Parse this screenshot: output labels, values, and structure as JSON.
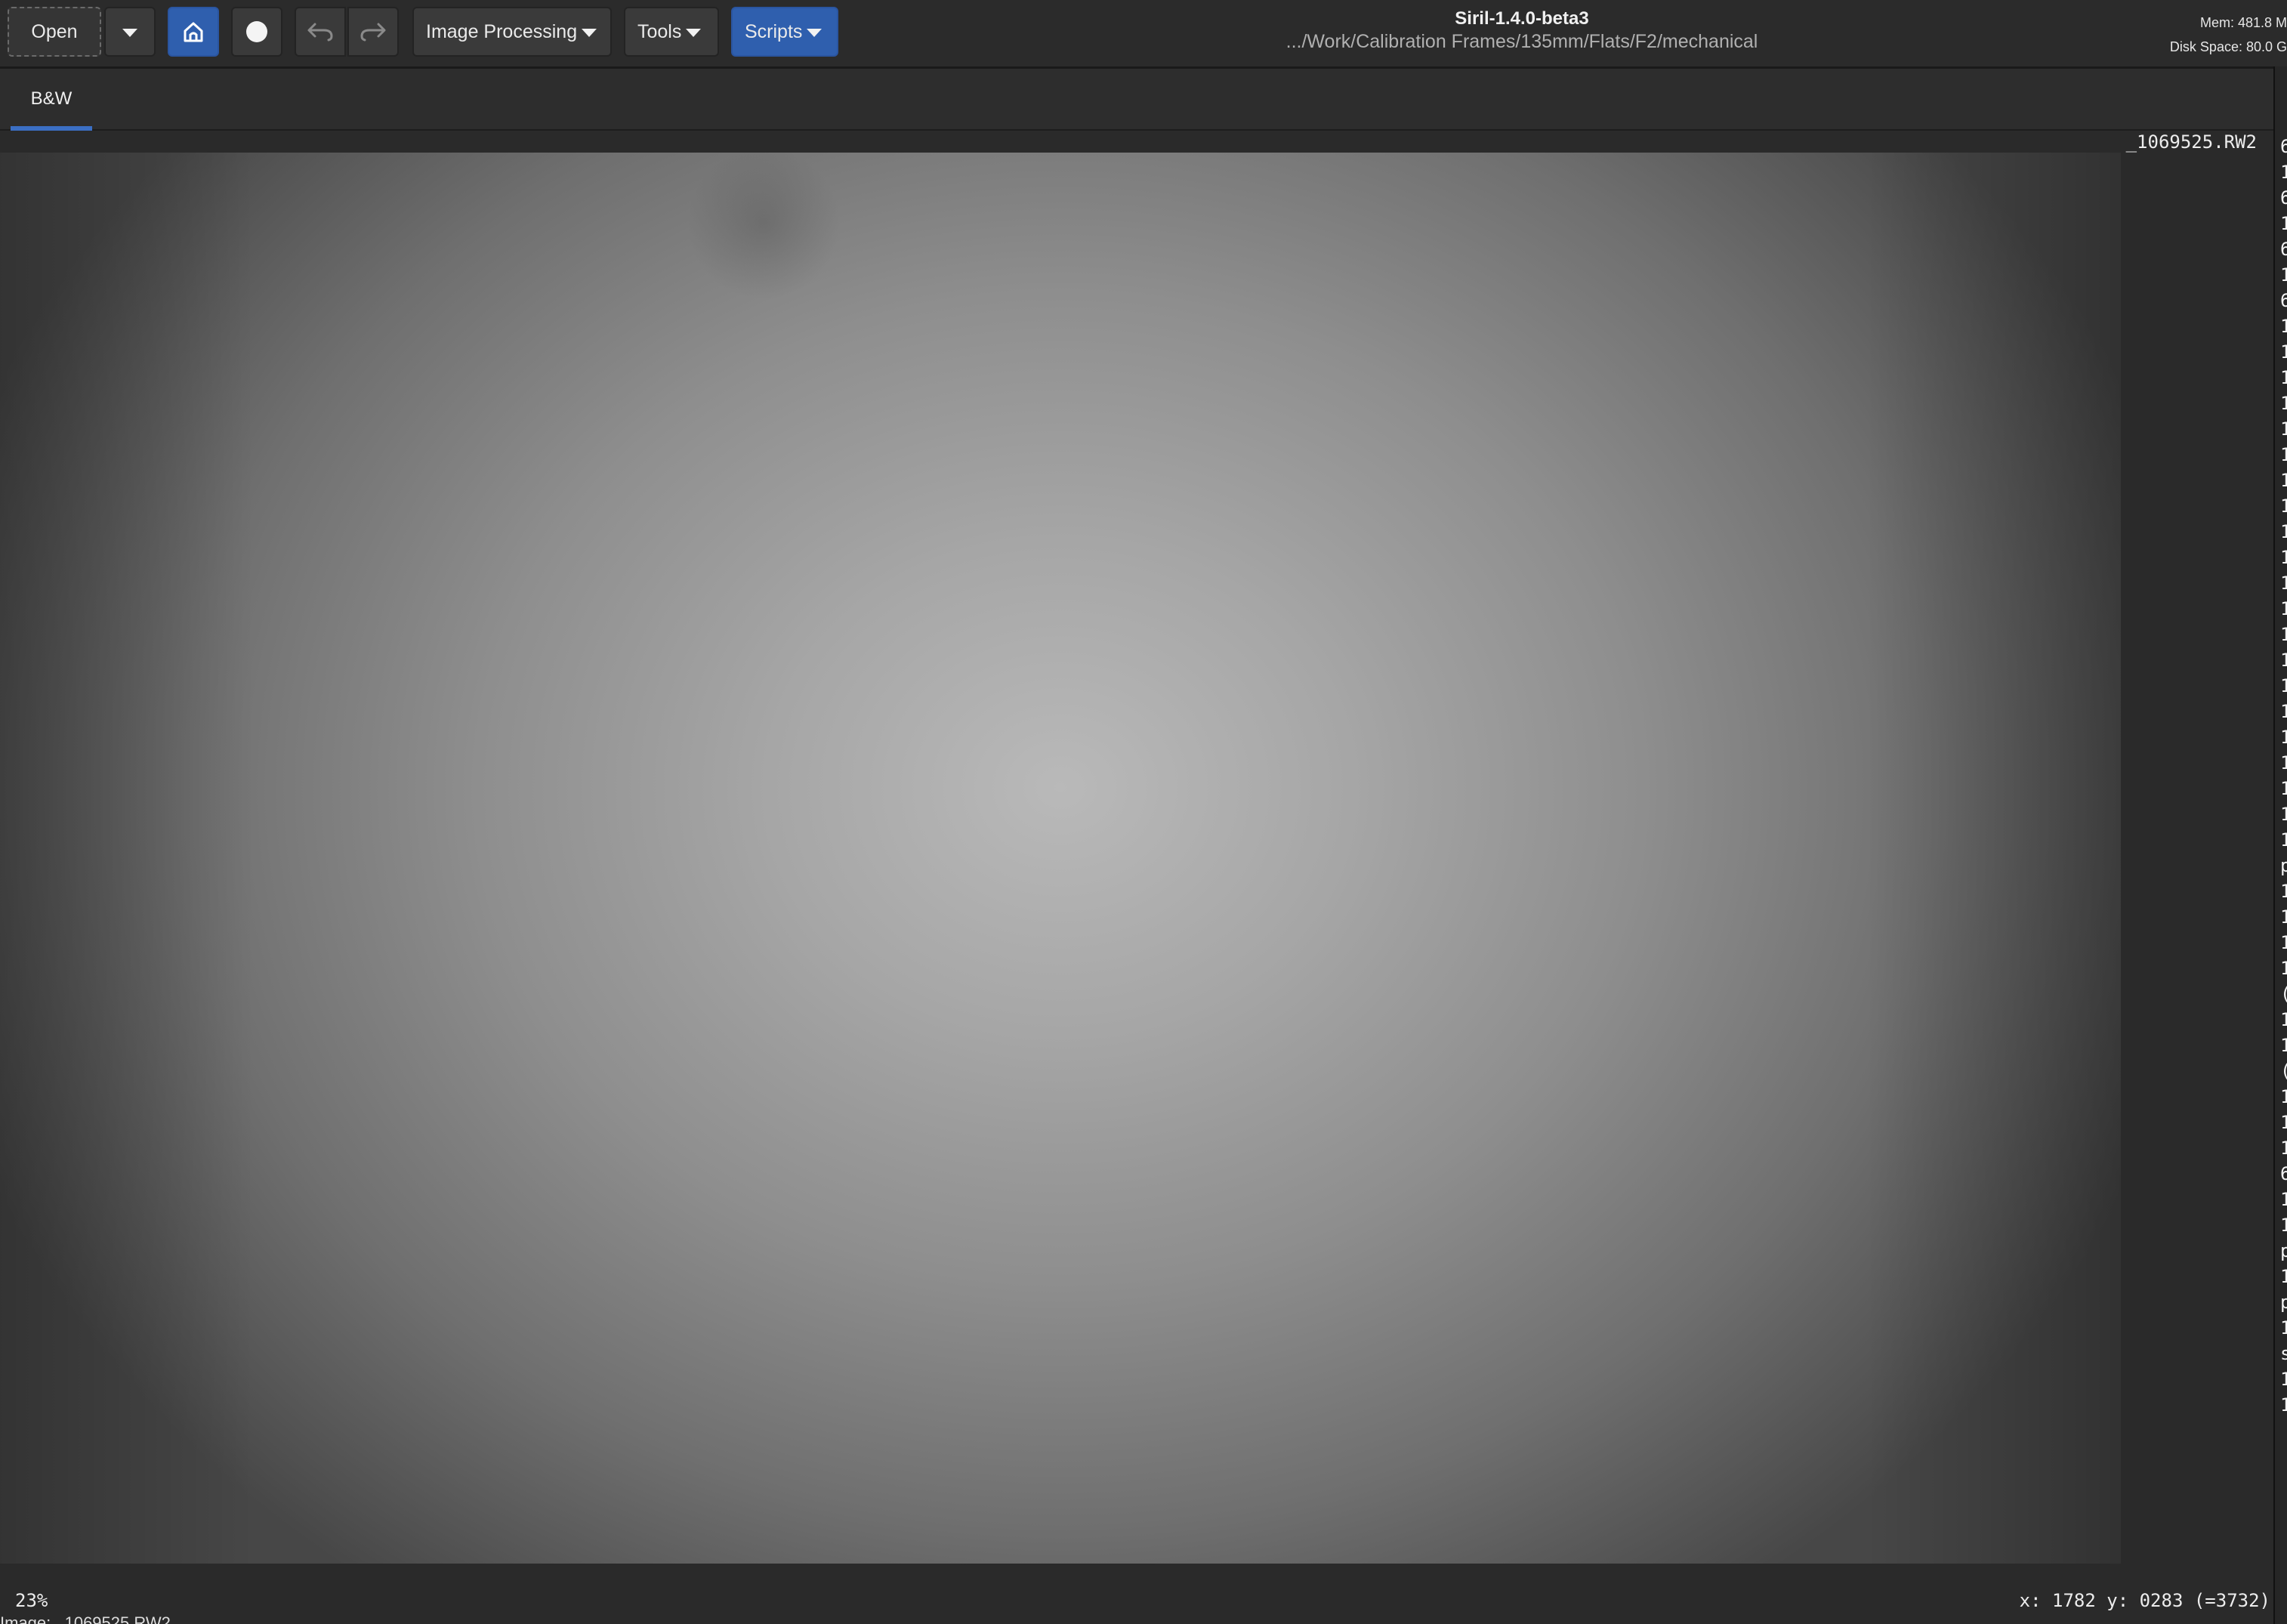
{
  "toolbar": {
    "open_label": "Open",
    "image_processing_label": "Image Processing",
    "tools_label": "Tools",
    "scripts_label": "Scripts",
    "accent_color": "#2f5fae"
  },
  "window": {
    "title": "Siril-1.4.0-beta3",
    "path": ".../Work/Calibration Frames/135mm/Flats/F2/mechanical",
    "mem": "Mem: 481.8 M",
    "disk_space": "Disk Space: 80.0 G"
  },
  "tabs": [
    {
      "label": "B&W",
      "active": true
    }
  ],
  "viewer": {
    "filename": "_1069525.RW2"
  },
  "log_strip": {
    "glyphs": [
      "6",
      "1",
      "6",
      "1",
      "6",
      "1",
      "6",
      "1",
      "1",
      "1",
      "1",
      "1",
      "1",
      "1",
      "1",
      "1",
      "1",
      "1",
      "1",
      "1",
      "1",
      "1",
      "1",
      "1",
      "1",
      "1",
      "1",
      "1",
      "p",
      "1",
      "1",
      "1",
      "1",
      "(",
      "1",
      "1",
      "(",
      "1",
      "1",
      "1",
      "6",
      "1",
      "1",
      "p",
      "1",
      "p",
      "1",
      "s",
      "1",
      "1"
    ]
  },
  "status": {
    "zoom": "23%",
    "coords": "x: 1782 y: 0283 (=3732)",
    "bottom_text": "Image: _1069525.RW2"
  }
}
